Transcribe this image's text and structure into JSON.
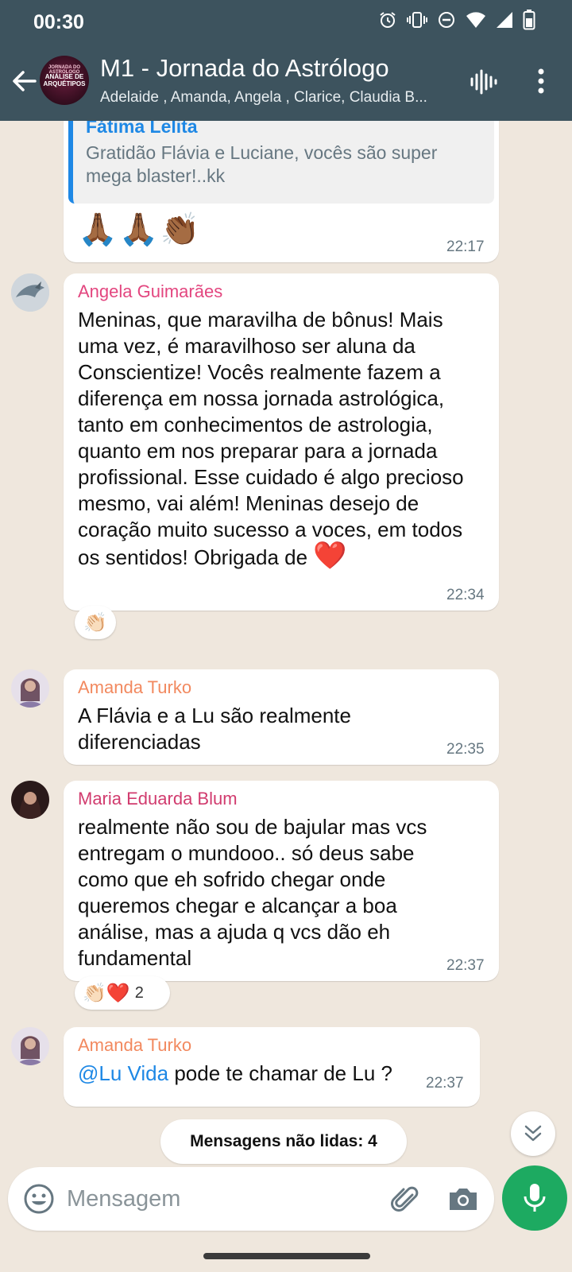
{
  "status_bar": {
    "time": "00:30"
  },
  "header": {
    "avatar_line1": "JORNADA DO ASTRÓLOGO",
    "avatar_line2": "ANÁLISE DE ARQUÉTIPOS",
    "title": "M1 - Jornada do Astrólogo",
    "members": "Adelaide , Amanda, Angela , Clarice, Claudia B..."
  },
  "messages": [
    {
      "quote_name": "Fátima Lelita",
      "quote_text": "Gratidão Flávia e Luciane, vocês são super mega blaster!..kk",
      "emojis": "🙏🏾🙏🏾👏🏾",
      "time": "22:17"
    },
    {
      "sender": "Angela Guimarães",
      "sender_color": "#e3467f",
      "text": "Meninas, que maravilha de bônus! Mais uma vez, é maravilhoso ser aluna da Conscientize! Vocês realmente fazem a diferença em nossa jornada astrológica, tanto em conhecimentos de astrologia, quanto em nos preparar para a jornada profissional. Esse cuidado é algo precioso mesmo, vai além! Meninas desejo de coração muito sucesso a voces, em todos os sentidos! Obrigada de",
      "trailing_emoji": "❤️",
      "time": "22:34",
      "reaction": "👏🏻"
    },
    {
      "sender": "Amanda Turko",
      "sender_color": "#f2895f",
      "text": "A Flávia e a Lu são realmente diferenciadas",
      "time": "22:35"
    },
    {
      "sender": "Maria Eduarda Blum",
      "sender_color": "#d13b6e",
      "text": "realmente não sou de bajular mas vcs entregam o mundooo.. só deus sabe como que eh sofrido chegar onde queremos chegar e alcançar a boa análise, mas a ajuda q vcs dão eh fundamental",
      "time": "22:37",
      "reactions": "👏🏻❤️",
      "reaction_count": "2"
    },
    {
      "sender": "Amanda Turko",
      "sender_color": "#f2895f",
      "mention": "@Lu Vida",
      "text": " pode te chamar de Lu ?",
      "time": "22:37"
    }
  ],
  "unread_label": "Mensagens não lidas: 4",
  "input": {
    "placeholder": "Mensagem"
  },
  "icons": {
    "back": "arrow-left-icon",
    "voice": "voice-call-icon",
    "menu": "more-vert-icon",
    "emoji": "emoji-icon",
    "attach": "paperclip-icon",
    "camera": "camera-icon",
    "mic": "microphone-icon",
    "scroll": "double-chevron-down-icon"
  },
  "colors": {
    "header": "#3d535e",
    "accent_green": "#1daa61",
    "mention": "#1e88e5",
    "chat_bg": "#efe7dd"
  }
}
